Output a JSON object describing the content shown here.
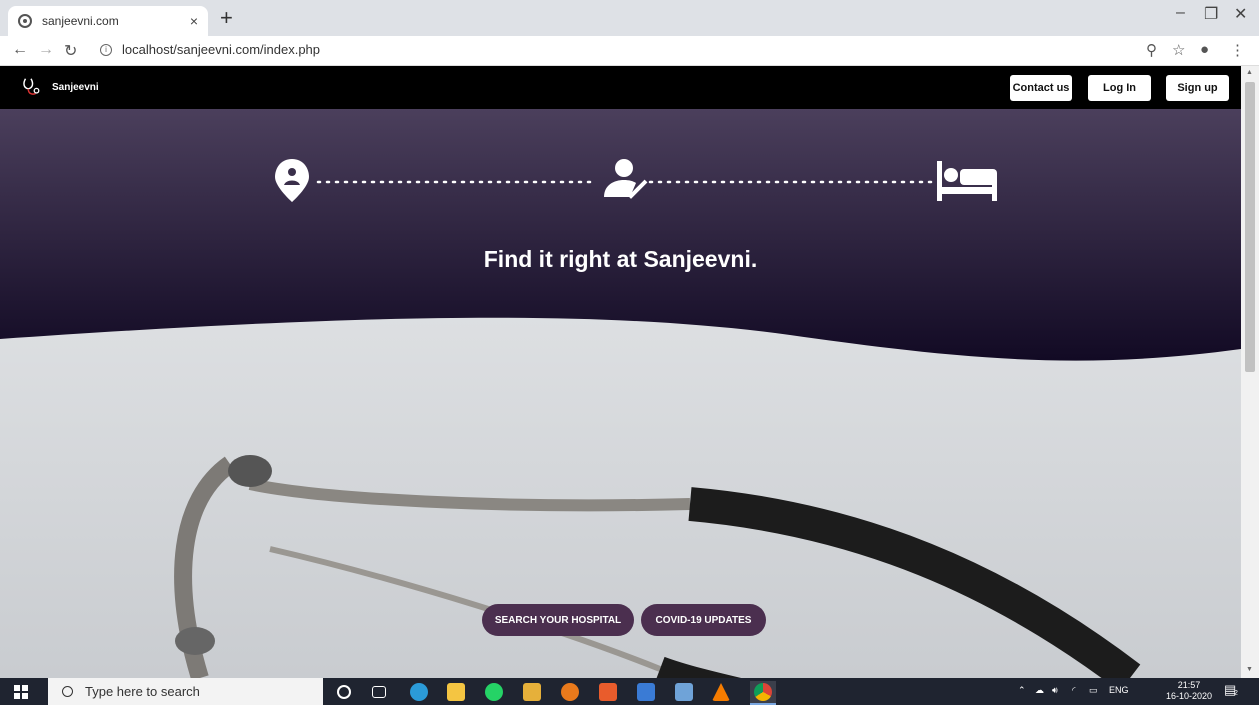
{
  "browser": {
    "tab_title": "sanjeevni.com",
    "tab_close": "×",
    "new_tab": "+",
    "url": "localhost/sanjeevni.com/index.php",
    "win_minimize": "–",
    "win_maximize": "❐",
    "win_close": "✕"
  },
  "nav": {
    "brand": "Sanjeevni",
    "contact": "Contact us",
    "login": "Log In",
    "signup": "Sign up"
  },
  "hero": {
    "tagline": "Find it right at Sanjeevni."
  },
  "cta": {
    "search_hospital": "SEARCH YOUR HOSPITAL",
    "covid": "COVID-19 UPDATES"
  },
  "taskbar": {
    "search_placeholder": "Type here to search",
    "lang": "ENG",
    "time": "21:57",
    "date": "16-10-2020",
    "notif_count": "2"
  },
  "colors": {
    "hero_top": "#4b3f5c",
    "hero_bottom": "#120a24",
    "cta": "#4b2f4f"
  }
}
